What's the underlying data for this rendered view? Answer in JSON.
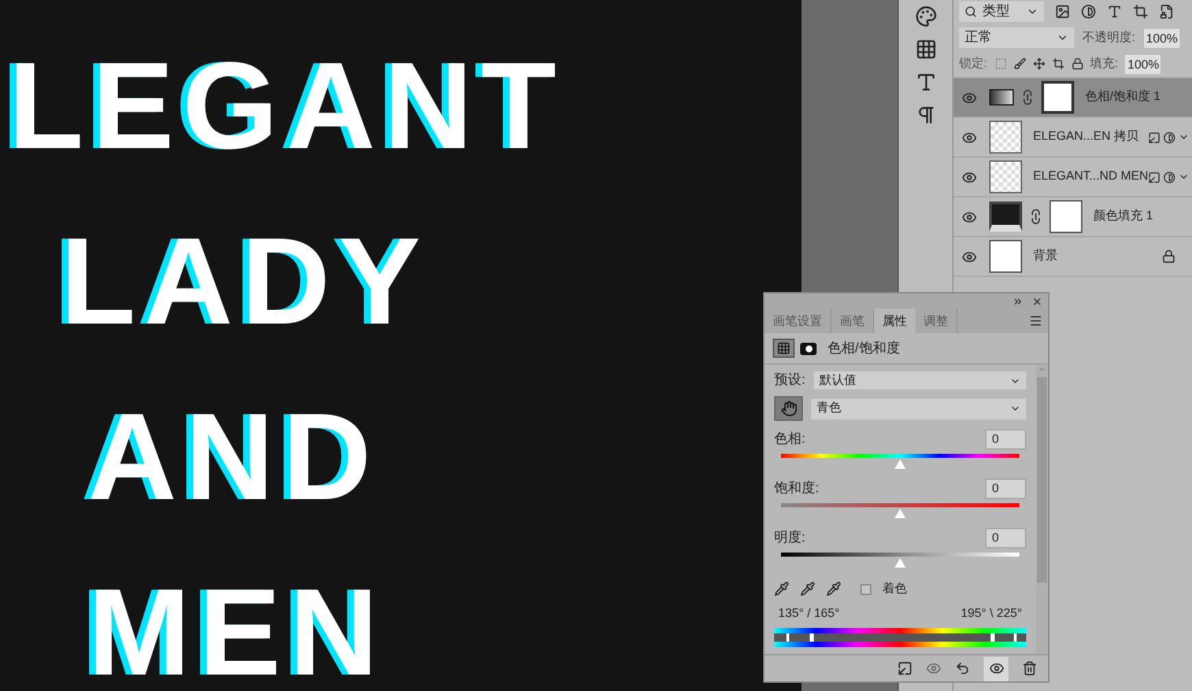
{
  "canvas": {
    "lines": [
      "LEGANT",
      "LADY",
      "AND",
      "MEN"
    ]
  },
  "layers_panel": {
    "filter": "类型",
    "blend_mode": "正常",
    "opacity_label": "不透明度:",
    "opacity": "100%",
    "lock_label": "锁定:",
    "fill_label": "填充:",
    "fill": "100%",
    "layers": [
      {
        "name": "色相/饱和度 1",
        "kind": "adjustment",
        "selected": true,
        "visible": true
      },
      {
        "name": "ELEGAN...EN 拷贝",
        "kind": "smart",
        "selected": false,
        "visible": true
      },
      {
        "name": "ELEGANT...ND MEN",
        "kind": "smart",
        "selected": false,
        "visible": true
      },
      {
        "name": "颜色填充 1",
        "kind": "fill",
        "selected": false,
        "visible": true
      },
      {
        "name": "背景",
        "kind": "background",
        "selected": false,
        "visible": true
      }
    ]
  },
  "properties_panel": {
    "tabs": [
      {
        "label": "画笔设置",
        "selected": false
      },
      {
        "label": "画笔",
        "selected": false
      },
      {
        "label": "属性",
        "selected": true
      },
      {
        "label": "调整",
        "selected": false
      }
    ],
    "title": "色相/饱和度",
    "preset_label": "预设:",
    "preset": "默认值",
    "channel": "青色",
    "sliders": [
      {
        "label": "色相:",
        "value": "0",
        "level": 0.5,
        "kind": "hue"
      },
      {
        "label": "饱和度:",
        "value": "0",
        "level": 0.5,
        "kind": "saturation"
      },
      {
        "label": "明度:",
        "value": "0",
        "level": 0.5,
        "kind": "lightness"
      }
    ],
    "colorize": {
      "label": "着色",
      "checked": false
    },
    "range_left": "135° / 165°",
    "range_right": "195° \\ 225°"
  }
}
